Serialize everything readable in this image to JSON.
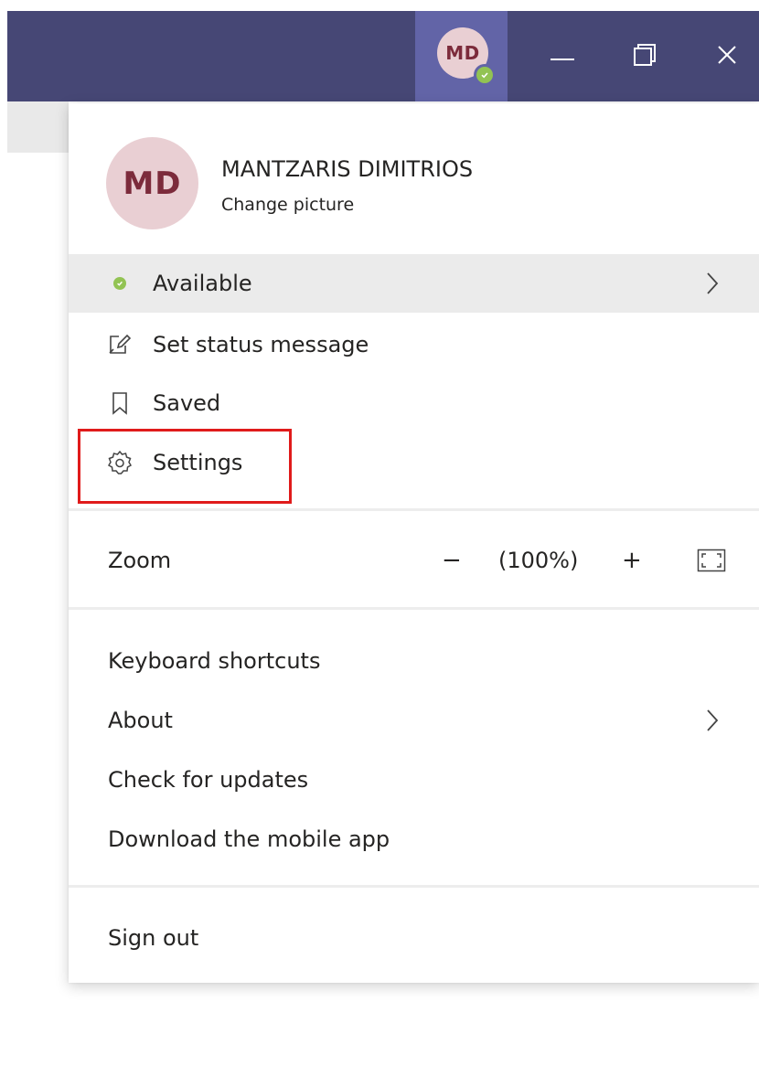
{
  "titlebar": {
    "avatar_initials": "MD",
    "minimize_icon": "minimize-icon",
    "maximize_icon": "restore-icon",
    "close_icon": "close-icon",
    "background_color": "#464775",
    "active_color": "#6264a7"
  },
  "profile": {
    "initials": "MD",
    "name": "MANTZARIS DIMITRIOS",
    "change_picture": "Change picture",
    "avatar_color": "#e9cfd3",
    "initials_color": "#7c2b3b"
  },
  "status": {
    "label": "Available",
    "color": "#92c353"
  },
  "items": {
    "set_status_message": "Set status message",
    "saved": "Saved",
    "settings": "Settings"
  },
  "zoom": {
    "label": "Zoom",
    "minus": "−",
    "value": "(100%)",
    "plus": "+"
  },
  "footer_items": {
    "keyboard_shortcuts": "Keyboard shortcuts",
    "about": "About",
    "check_for_updates": "Check for updates",
    "download_mobile_app": "Download the mobile app",
    "sign_out": "Sign out"
  },
  "highlight_color": "#e01b1b"
}
